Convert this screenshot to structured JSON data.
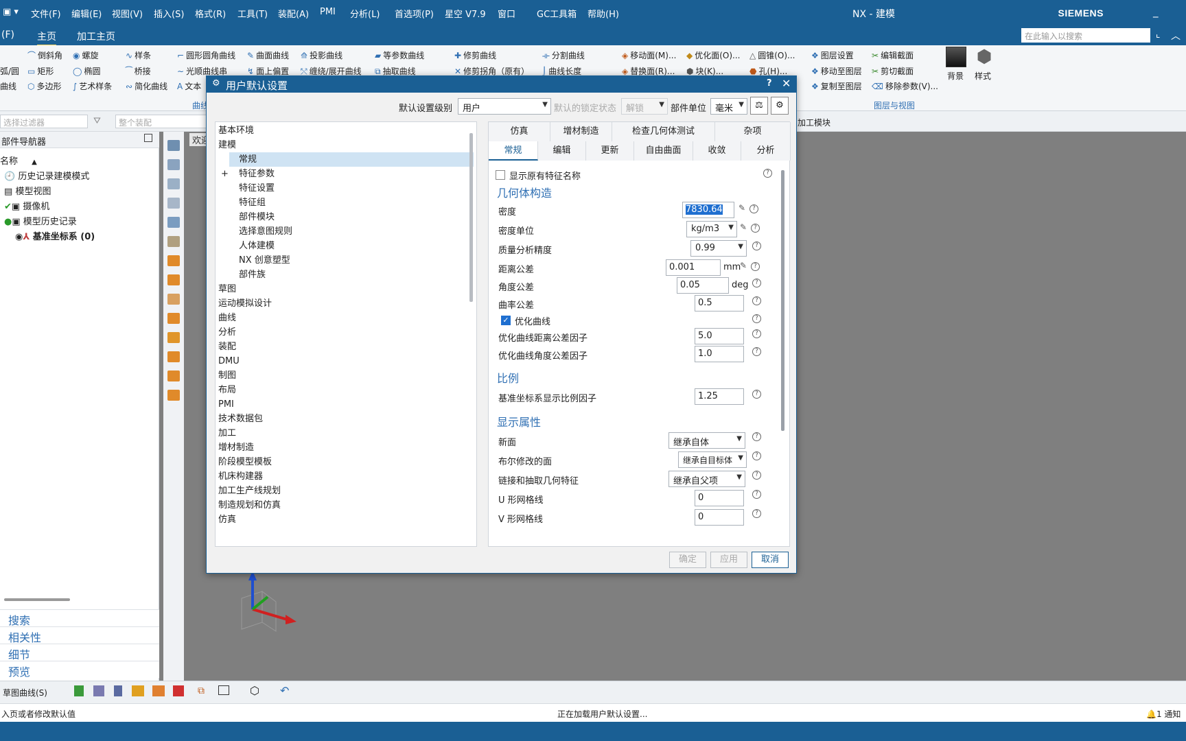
{
  "menubar": {
    "items": [
      "文件(F)",
      "编辑(E)",
      "视图(V)",
      "插入(S)",
      "格式(R)",
      "工具(T)",
      "装配(A)",
      "PMI",
      "分析(L)",
      "首选项(P)",
      "星空 V7.9",
      "窗口",
      "GC工具箱",
      "帮助(H)"
    ],
    "title": "NX - 建模",
    "brand": "SIEMENS"
  },
  "ribbon_tabs": {
    "f_label": "(F)",
    "home": "主页",
    "machining": "加工主页",
    "search_placeholder": "在此输入以搜索"
  },
  "ribbon": {
    "row1": [
      "倒斜角",
      "螺旋",
      "样条",
      "圆形圆角曲线",
      "曲面曲线",
      "投影曲线",
      "等参数曲线",
      "修剪曲线",
      "分割曲线",
      "移动面(M)...",
      "优化面(O)...",
      "圆锥(O)...",
      "图层设置",
      "编辑截面"
    ],
    "row2": [
      "弧/圆",
      "矩形",
      "椭圆",
      "桥接",
      "光顺曲线串",
      "面上偏置",
      "缠绕/展开曲线",
      "抽取曲线",
      "修剪拐角（原有）",
      "曲线长度",
      "替换面(R)...",
      "块(K)...",
      "孔(H)...",
      "移动至图层",
      "剪切截面"
    ],
    "row3": [
      "曲线",
      "多边形",
      "艺术样条",
      "简化曲线",
      "文本",
      "复制至图层",
      "移除参数(V)..."
    ],
    "groups": [
      "曲线",
      "图层与视图"
    ],
    "big_buttons": [
      "背景",
      "样式"
    ]
  },
  "filterbar": {
    "filter_placeholder": "选择过滤器",
    "assembly_placeholder": "整个装配",
    "machining_module": "加工模块"
  },
  "part_navigator": {
    "title": "部件导航器",
    "col_name": "名称",
    "rows": [
      "历史记录建模模式",
      "模型视图",
      "摄像机",
      "模型历史记录",
      "基准坐标系 (0)"
    ],
    "bottom_tabs": [
      "搜索",
      "相关性",
      "细节",
      "预览"
    ]
  },
  "graphics": {
    "tab_label": "欢迎"
  },
  "dialog": {
    "title": "用户默认设置",
    "level_label": "默认设置级别",
    "level_value": "用户",
    "lock_label": "默认的锁定状态",
    "lock_value": "解锁",
    "unit_label": "部件单位",
    "unit_value": "毫米",
    "tree": [
      {
        "label": "基本环境"
      },
      {
        "label": "建模"
      },
      {
        "label": "常规"
      },
      {
        "label": "特征参数"
      },
      {
        "label": "特征设置"
      },
      {
        "label": "特征组"
      },
      {
        "label": "部件模块"
      },
      {
        "label": "选择意图规则"
      },
      {
        "label": "人体建模"
      },
      {
        "label": "NX 创意塑型"
      },
      {
        "label": "部件族"
      },
      {
        "label": "草图"
      },
      {
        "label": "运动模拟设计"
      },
      {
        "label": "曲线"
      },
      {
        "label": "分析"
      },
      {
        "label": "装配"
      },
      {
        "label": "DMU"
      },
      {
        "label": "制图"
      },
      {
        "label": "布局"
      },
      {
        "label": "PMI"
      },
      {
        "label": "技术数据包"
      },
      {
        "label": "加工"
      },
      {
        "label": "增材制造"
      },
      {
        "label": "阶段模型模板"
      },
      {
        "label": "机床构建器"
      },
      {
        "label": "加工生产线规划"
      },
      {
        "label": "制造规划和仿真"
      },
      {
        "label": "仿真"
      }
    ],
    "tabs_row1": [
      "仿真",
      "增材制造",
      "检查几何体测试",
      "杂项"
    ],
    "tabs_row2": [
      "常规",
      "编辑",
      "更新",
      "自由曲面",
      "收敛",
      "分析"
    ],
    "show_feature_name": "显示原有特征名称",
    "sect_geometry": "几何体构造",
    "density_label": "密度",
    "density_value": "7830.64",
    "density_unit_label": "密度单位",
    "density_unit_value": "kg/m3",
    "mass_precision_label": "质量分析精度",
    "mass_precision_value": "0.99",
    "distance_tol_label": "距离公差",
    "distance_tol_value": "0.001",
    "distance_tol_unit": "mm",
    "angle_tol_label": "角度公差",
    "angle_tol_value": "0.05",
    "angle_tol_unit": "deg",
    "curvature_tol_label": "曲率公差",
    "curvature_tol_value": "0.5",
    "optimize_curve": "优化曲线",
    "opt_dist_label": "优化曲线距离公差因子",
    "opt_dist_value": "5.0",
    "opt_angle_label": "优化曲线角度公差因子",
    "opt_angle_value": "1.0",
    "sect_scale": "比例",
    "csys_scale_label": "基准坐标系显示比例因子",
    "csys_scale_value": "1.25",
    "sect_display": "显示属性",
    "new_face_label": "新面",
    "new_face_value": "继承自体",
    "boolean_face_label": "布尔修改的面",
    "boolean_face_value": "继承自目标体",
    "linked_label": "链接和抽取几何特征",
    "linked_value": "继承自父项",
    "u_grid_label": "U 形网格线",
    "u_grid_value": "0",
    "v_grid_label": "V 形网格线",
    "v_grid_value": "0",
    "ok": "确定",
    "apply": "应用",
    "cancel": "取消"
  },
  "bottombar": {
    "sketch_curve": "草图曲线(S)"
  },
  "statusbar": {
    "left": "入页或者修改默认值",
    "center": "正在加载用户默认设置...",
    "right": "1 通知"
  },
  "colors": {
    "accent": "#1a5f94",
    "selected_row": "#cfe3f3",
    "section_text": "#2f6fb3"
  }
}
